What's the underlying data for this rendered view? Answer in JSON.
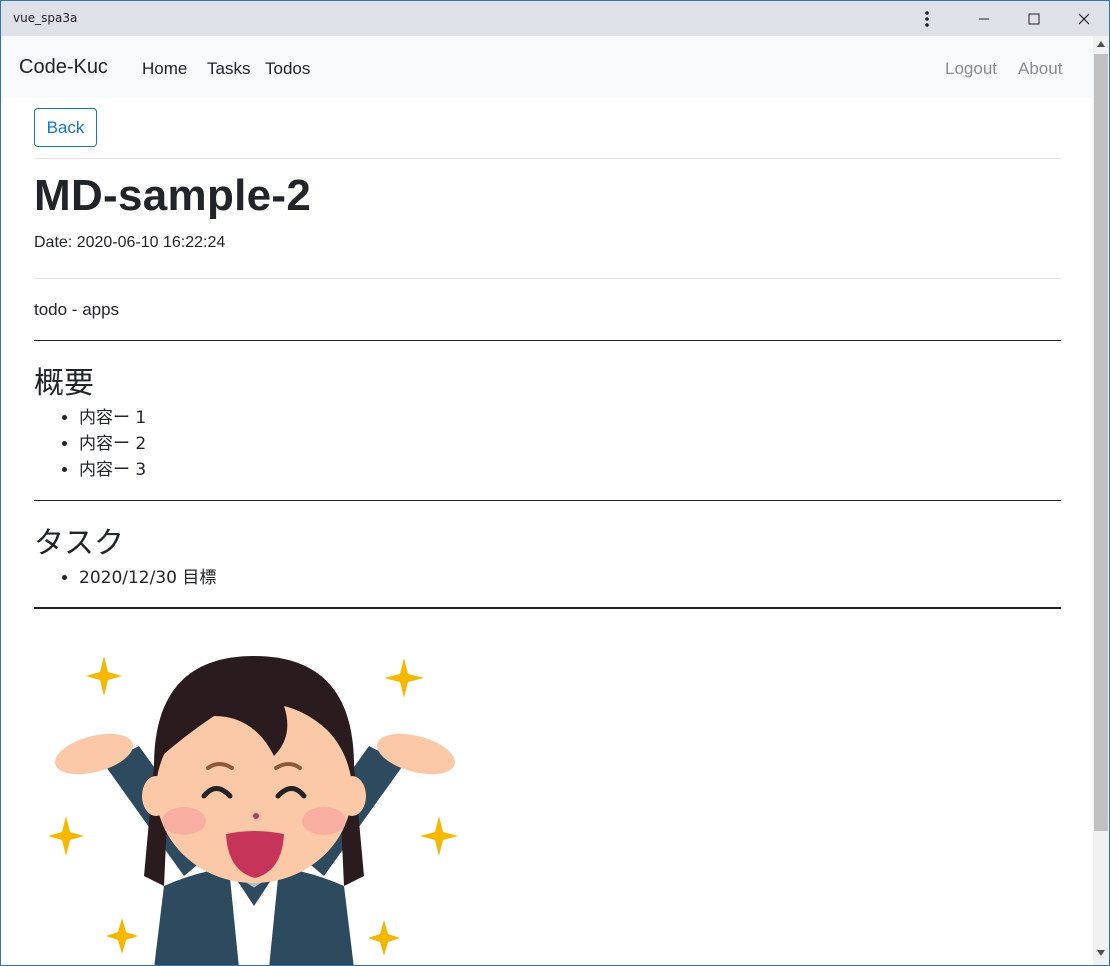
{
  "window": {
    "title": "vue_spa3a"
  },
  "navbar": {
    "brand": "Code-Kuc",
    "links_left": [
      "Home",
      "Tasks",
      "Todos"
    ],
    "links_right": [
      "Logout",
      "About"
    ]
  },
  "page": {
    "back_label": "Back",
    "title": "MD-sample-2",
    "date": "Date: 2020-06-10 16:22:24",
    "description": "todo - apps",
    "sections": [
      {
        "heading": "概要",
        "items": [
          "内容ー 1",
          "内容ー 2",
          "内容ー 3"
        ]
      },
      {
        "heading": "タスク",
        "items": [
          "2020/12/30 目標"
        ]
      }
    ]
  },
  "colors": {
    "accent": "#1a73c9",
    "navbar_bg": "#f8f9fa",
    "titlebar_bg": "#dee1e6"
  }
}
